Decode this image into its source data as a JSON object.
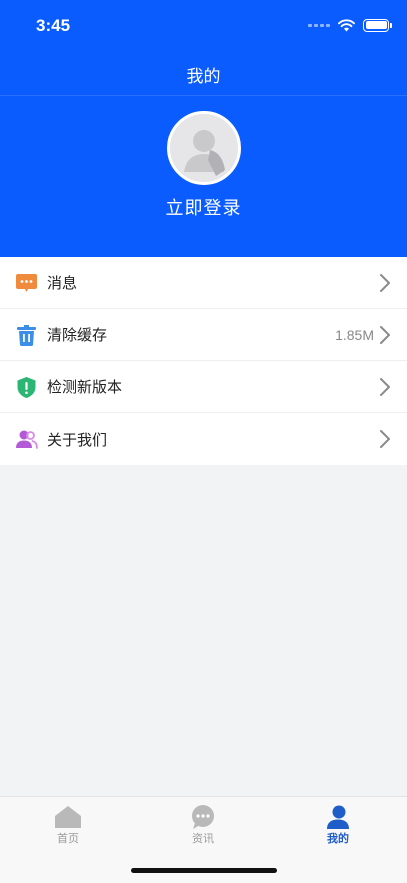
{
  "status_bar": {
    "time": "3:45"
  },
  "nav": {
    "title": "我的"
  },
  "profile": {
    "login_label": "立即登录"
  },
  "menu": {
    "items": [
      {
        "label": "消息",
        "icon": "message-icon",
        "value": ""
      },
      {
        "label": "清除缓存",
        "icon": "trash-icon",
        "value": "1.85M"
      },
      {
        "label": "检测新版本",
        "icon": "shield-icon",
        "value": ""
      },
      {
        "label": "关于我们",
        "icon": "users-icon",
        "value": ""
      }
    ]
  },
  "tabbar": {
    "tabs": [
      {
        "label": "首页",
        "icon": "home-icon",
        "active": false
      },
      {
        "label": "资讯",
        "icon": "chat-icon",
        "active": false
      },
      {
        "label": "我的",
        "icon": "person-icon",
        "active": true
      }
    ]
  },
  "colors": {
    "primary": "#0b5cff",
    "tab_active": "#1f5ec8",
    "tab_inactive": "#9a9a9a",
    "message_icon": "#f08a3c",
    "trash_icon": "#3b8fe6",
    "shield_icon": "#2bb673",
    "users_icon": "#b45ad6"
  }
}
